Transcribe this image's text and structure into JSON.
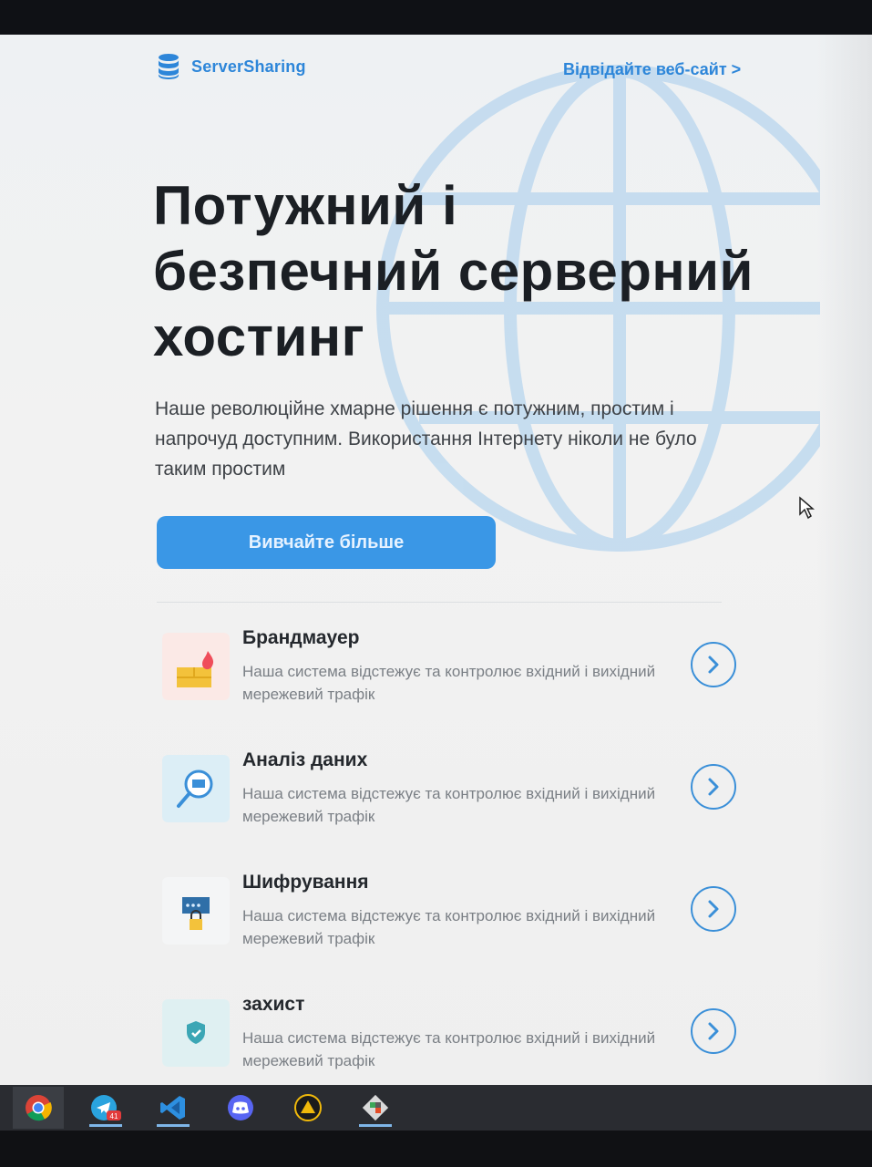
{
  "brand": {
    "name": "ServerSharing",
    "icon": "database-icon",
    "color": "#2d86d9"
  },
  "header": {
    "visit_link": "Відвідайте веб-сайт >"
  },
  "hero": {
    "title_lines": [
      "Потужний і",
      "безпечний серверний",
      "хостинг"
    ],
    "description": "Наше революційне хмарне рішення є потужним, простим і напрочуд доступним. Використання Інтернету ніколи не було таким простим",
    "cta_label": "Вивчайте більше",
    "accent": "#3a97e6"
  },
  "features": [
    {
      "title": "Брандмауер",
      "description": "Наша система відстежує та контролює вхідний і вихідний мережевий трафік",
      "icon": "firewall-icon"
    },
    {
      "title": "Аналіз даних",
      "description": "Наша система відстежує та контролює вхідний і вихідний мережевий трафік",
      "icon": "data-analysis-icon"
    },
    {
      "title": "Шифрування",
      "description": "Наша система відстежує та контролює вхідний і вихідний мережевий трафік",
      "icon": "encryption-icon"
    },
    {
      "title": "захист",
      "description": "Наша система відстежує та контролює вхідний і вихідний мережевий трафік",
      "icon": "shield-icon"
    }
  ],
  "taskbar": {
    "apps": [
      "chrome-icon",
      "telegram-icon",
      "vscode-icon",
      "discord-icon",
      "app-triangle-icon",
      "app-git-icon"
    ],
    "telegram_badge": "41"
  }
}
